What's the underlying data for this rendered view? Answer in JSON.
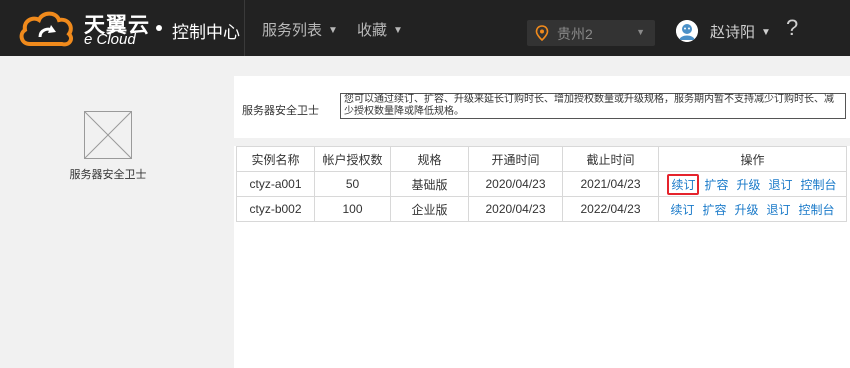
{
  "header": {
    "logo_cn": "天翼云",
    "logo_en": "e Cloud",
    "console_title": "控制中心",
    "nav": [
      {
        "label": "服务列表"
      },
      {
        "label": "收藏"
      }
    ],
    "region": "贵州2",
    "user_name": "赵诗阳",
    "help_glyph": "?",
    "colors": {
      "bar": "#222222",
      "logo_orange": "#f08a1c"
    }
  },
  "sidebar": {
    "product_name": "服务器安全卫士"
  },
  "main": {
    "info_label": "服务器安全卫士",
    "info_text": "您可以通过续订、扩容、升级来延长订购时长、增加授权数量或升级规格，服务期内暂不支持减少订购时长、减少授权数量降或降低规格。",
    "table": {
      "headers": [
        "实例名称",
        "帐户授权数",
        "规格",
        "开通时间",
        "截止时间",
        "操作"
      ],
      "rows": [
        {
          "name": "ctyz-a001",
          "licenses": "50",
          "spec": "基础版",
          "start": "2020/04/23",
          "end": "2021/04/23",
          "ops": [
            "续订",
            "扩容",
            "升级",
            "退订",
            "控制台"
          ]
        },
        {
          "name": "ctyz-b002",
          "licenses": "100",
          "spec": "企业版",
          "start": "2020/04/23",
          "end": "2022/04/23",
          "ops": [
            "续订",
            "扩容",
            "升级",
            "退订",
            "控制台"
          ]
        }
      ]
    },
    "link_color": "#1a7ac9",
    "highlight_color": "#e5232c"
  }
}
